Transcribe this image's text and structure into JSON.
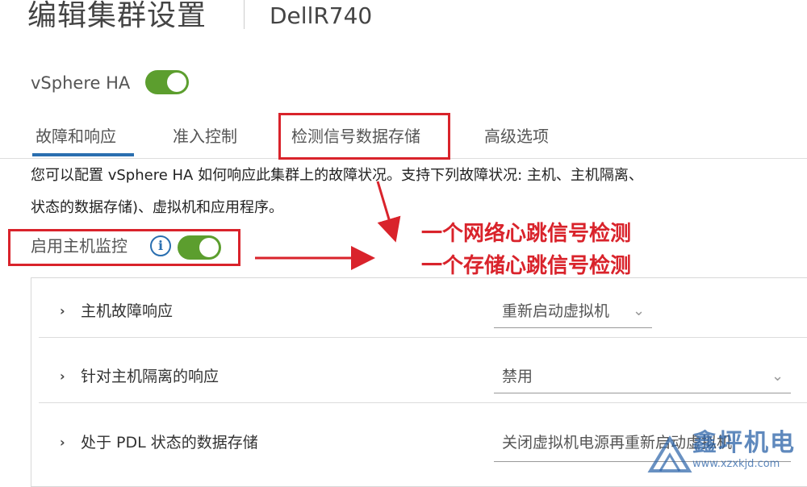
{
  "header": {
    "title": "编辑集群设置",
    "cluster_name": "DellR740"
  },
  "ha": {
    "label": "vSphere HA",
    "enabled": true
  },
  "tabs": [
    {
      "label": "故障和响应",
      "active": true
    },
    {
      "label": "准入控制",
      "active": false
    },
    {
      "label": "检测信号数据存储",
      "active": false
    },
    {
      "label": "高级选项",
      "active": false
    }
  ],
  "description": {
    "line1": "您可以配置 vSphere HA 如何响应此集群上的故障状况。支持下列故障状况: 主机、主机隔离、",
    "line2": "状态的数据存储)、虚拟机和应用程序。"
  },
  "host_monitoring": {
    "label": "启用主机监控",
    "enabled": true
  },
  "annotations": {
    "note1": "一个网络心跳信号检测",
    "note2": "一个存储心跳信号检测",
    "color": "#d9232b"
  },
  "rows": [
    {
      "label": "主机故障响应",
      "value": "重新启动虚拟机"
    },
    {
      "label": "针对主机隔离的响应",
      "value": "禁用"
    },
    {
      "label": "处于 PDL 状态的数据存储",
      "value": "关闭虚拟机电源再重新启动虚拟机"
    }
  ],
  "watermark": {
    "brand": "鑫坪机电",
    "url": "www.xzxkjd.com"
  },
  "colors": {
    "toggle_on": "#5c9e2e",
    "accent": "#2a6fb0"
  }
}
